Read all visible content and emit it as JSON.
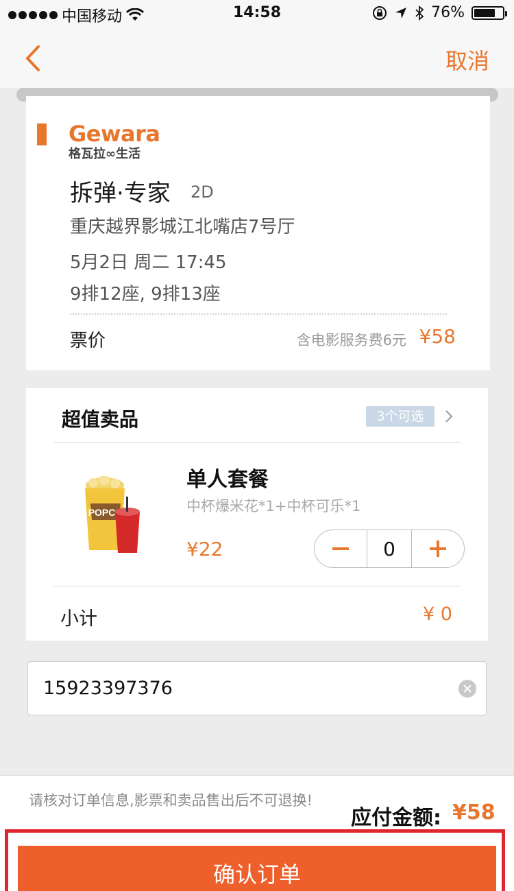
{
  "status_bar": {
    "carrier": "中国移动",
    "time": "14:58",
    "battery": "76%",
    "battery_level": 0.76
  },
  "nav": {
    "cancel_label": "取消"
  },
  "ticket": {
    "brand_name": "Gewara",
    "brand_sub": "格瓦拉∞生活",
    "movie_title": "拆弹·专家",
    "format": "2D",
    "cinema": "重庆越界影城江北嘴店7号厅",
    "showtime": "5月2日 周二 17:45",
    "seats": "9排12座, 9排13座",
    "price_label": "票价",
    "price_note": "含电影服务费6元",
    "price_value": "¥58"
  },
  "snacks": {
    "title": "超值卖品",
    "badge": "3个可选",
    "item": {
      "name": "单人套餐",
      "description": "中杯爆米花*1+中杯可乐*1",
      "price": "¥22",
      "quantity": "0"
    },
    "subtotal_label": "小计",
    "subtotal_value": "¥ 0"
  },
  "phone": {
    "value": "15923397376"
  },
  "footer": {
    "note": "请核对订单信息,影票和卖品售出后不可退换!",
    "due_label": "应付金额:",
    "due_value": "¥58",
    "confirm_label": "确认订单"
  },
  "colors": {
    "accent": "#e8772e",
    "confirm_button": "#ef5f2c",
    "highlight_frame": "#e0262e"
  }
}
